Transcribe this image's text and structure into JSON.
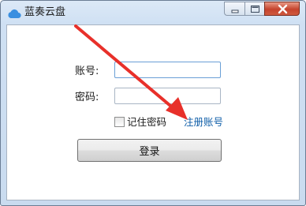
{
  "window": {
    "title": "蓝奏云盘",
    "app_icon": "cloud-icon",
    "controls": [
      "minimize-icon",
      "maximize-icon",
      "close-icon"
    ]
  },
  "form": {
    "account_label": "账号:",
    "account_value": "",
    "password_label": "密码:",
    "password_value": "",
    "remember_label": "记住密码",
    "remember_checked": false,
    "register_link": "注册账号",
    "login_button": "登录"
  },
  "colors": {
    "link": "#0f5ea8",
    "annotation_arrow": "#e8302a",
    "app_icon": "#3a8fe0"
  }
}
